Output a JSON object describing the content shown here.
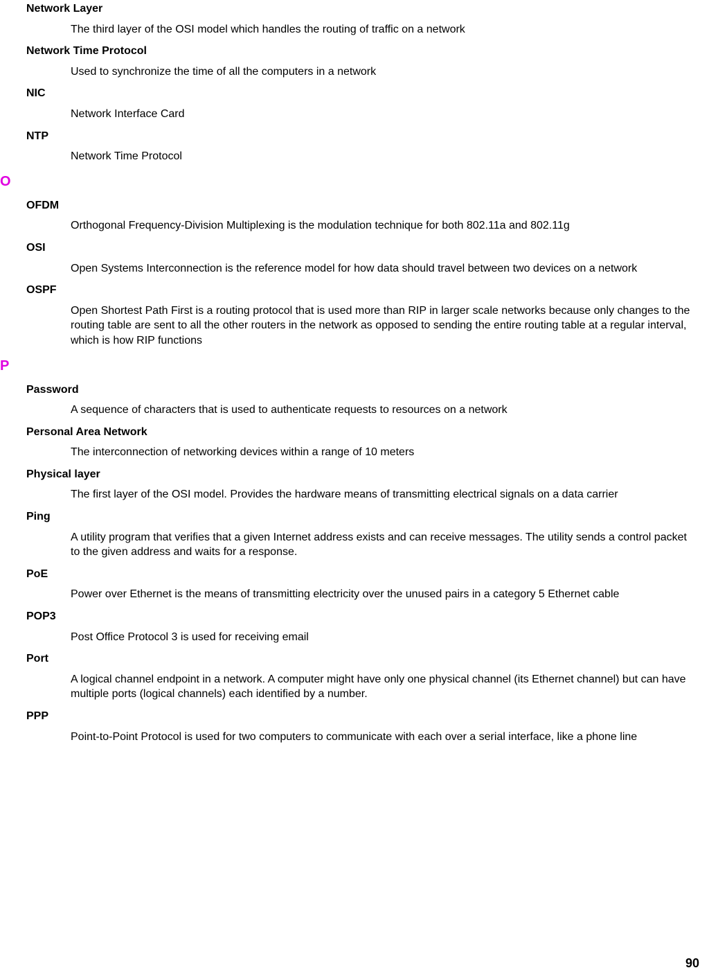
{
  "entries": [
    {
      "type": "term",
      "text": "Network Layer",
      "first": true
    },
    {
      "type": "def",
      "text": "The third layer of the OSI model which handles the routing of traffic on a network"
    },
    {
      "type": "term",
      "text": "Network Time Protocol"
    },
    {
      "type": "def",
      "text": "Used to synchronize the time of all the computers in a network"
    },
    {
      "type": "term",
      "text": "NIC"
    },
    {
      "type": "def",
      "text": "Network Interface Card"
    },
    {
      "type": "term",
      "text": "NTP"
    },
    {
      "type": "def",
      "text": "Network Time Protocol"
    },
    {
      "type": "letter",
      "text": "O"
    },
    {
      "type": "term",
      "text": "OFDM"
    },
    {
      "type": "def",
      "text": "Orthogonal Frequency-Division Multiplexing is the modulation technique for both 802.11a and 802.11g"
    },
    {
      "type": "term",
      "text": "OSI"
    },
    {
      "type": "def",
      "text": "Open Systems Interconnection is the reference model for how data should travel between two devices on a network"
    },
    {
      "type": "term",
      "text": "OSPF"
    },
    {
      "type": "def",
      "text": "Open Shortest Path First is a routing protocol that is used more than RIP in larger scale networks because only changes to the routing table are sent to all the other routers in the network as opposed to sending the entire routing table at a regular interval, which is how RIP functions"
    },
    {
      "type": "letter",
      "text": "P"
    },
    {
      "type": "term",
      "text": "Password"
    },
    {
      "type": "def",
      "text": "A sequence of characters that is used to authenticate requests to resources on a network"
    },
    {
      "type": "term",
      "text": "Personal Area Network"
    },
    {
      "type": "def",
      "text": "The interconnection of networking devices within a range of 10 meters"
    },
    {
      "type": "term",
      "text": "Physical layer"
    },
    {
      "type": "def",
      "text": "The first layer of the OSI model. Provides the hardware means of transmitting electrical signals on a data carrier"
    },
    {
      "type": "term",
      "text": "Ping"
    },
    {
      "type": "def",
      "text": "A utility program that verifies that a given Internet address exists and can receive messages. The utility sends a control packet to the given address and waits for a response."
    },
    {
      "type": "term",
      "text": "PoE"
    },
    {
      "type": "def",
      "text": "Power over Ethernet is the means of transmitting electricity over the unused pairs in a category 5 Ethernet cable"
    },
    {
      "type": "term",
      "text": "POP3"
    },
    {
      "type": "def",
      "text": "Post Office Protocol 3 is used for receiving email"
    },
    {
      "type": "term",
      "text": "Port"
    },
    {
      "type": "def",
      "text": "A logical channel endpoint in a network. A computer might have only one physical channel (its Ethernet channel) but can have multiple ports (logical channels) each identified by a number."
    },
    {
      "type": "term",
      "text": "PPP"
    },
    {
      "type": "def",
      "text": "Point-to-Point Protocol is used for two computers to communicate with each over a serial interface, like a phone line"
    }
  ],
  "pageNumber": "90"
}
